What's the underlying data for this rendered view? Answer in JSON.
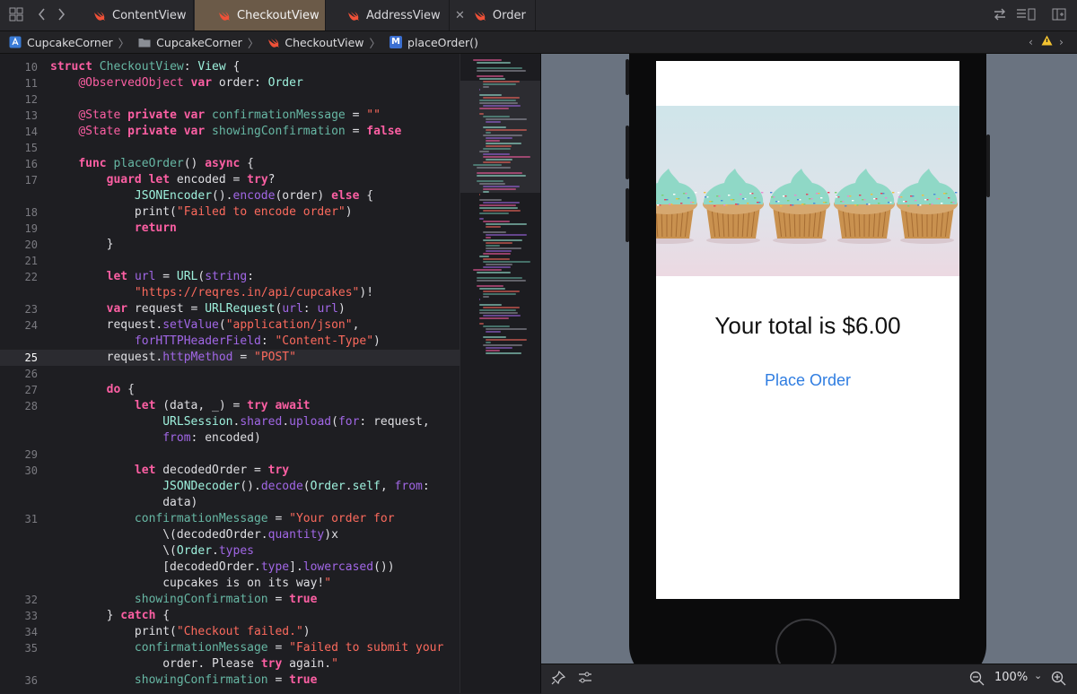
{
  "tabs": {
    "items": [
      {
        "label": "ContentView"
      },
      {
        "label": "CheckoutView"
      },
      {
        "label": "AddressView"
      },
      {
        "label": "Order"
      }
    ]
  },
  "breadcrumb": {
    "project": "CupcakeCorner",
    "folder": "CupcakeCorner",
    "file": "CheckoutView",
    "method_badge": "M",
    "method": "placeOrder()"
  },
  "editor": {
    "lines": [
      {
        "n": "10",
        "code": "struct CheckoutView: View {"
      },
      {
        "n": "11",
        "code": "    @ObservedObject var order: Order"
      },
      {
        "n": "12",
        "code": ""
      },
      {
        "n": "13",
        "code": "    @State private var confirmationMessage = \"\""
      },
      {
        "n": "14",
        "code": "    @State private var showingConfirmation = false"
      },
      {
        "n": "15",
        "code": ""
      },
      {
        "n": "16",
        "code": "    func placeOrder() async {"
      },
      {
        "n": "17",
        "code": "        guard let encoded = try?"
      },
      {
        "n": "",
        "code": "            JSONEncoder().encode(order) else {"
      },
      {
        "n": "18",
        "code": "            print(\"Failed to encode order\")"
      },
      {
        "n": "19",
        "code": "            return"
      },
      {
        "n": "20",
        "code": "        }"
      },
      {
        "n": "21",
        "code": ""
      },
      {
        "n": "22",
        "code": "        let url = URL(string:"
      },
      {
        "n": "",
        "code": "            \"https://reqres.in/api/cupcakes\")!"
      },
      {
        "n": "23",
        "code": "        var request = URLRequest(url: url)"
      },
      {
        "n": "24",
        "code": "        request.setValue(\"application/json\","
      },
      {
        "n": "",
        "code": "            forHTTPHeaderField: \"Content-Type\")"
      },
      {
        "n": "25",
        "code": "        request.httpMethod = \"POST\""
      },
      {
        "n": "26",
        "code": ""
      },
      {
        "n": "27",
        "code": "        do {"
      },
      {
        "n": "28",
        "code": "            let (data, _) = try await"
      },
      {
        "n": "",
        "code": "                URLSession.shared.upload(for: request,"
      },
      {
        "n": "",
        "code": "                from: encoded)"
      },
      {
        "n": "29",
        "code": ""
      },
      {
        "n": "30",
        "code": "            let decodedOrder = try"
      },
      {
        "n": "",
        "code": "                JSONDecoder().decode(Order.self, from:"
      },
      {
        "n": "",
        "code": "                data)"
      },
      {
        "n": "31",
        "code": "            confirmationMessage = \"Your order for"
      },
      {
        "n": "",
        "code": "                \\(decodedOrder.quantity)x"
      },
      {
        "n": "",
        "code": "                \\(Order.types"
      },
      {
        "n": "",
        "code": "                [decodedOrder.type].lowercased())"
      },
      {
        "n": "",
        "code": "                cupcakes is on its way!\""
      },
      {
        "n": "32",
        "code": "            showingConfirmation = true"
      },
      {
        "n": "33",
        "code": "        } catch {"
      },
      {
        "n": "34",
        "code": "            print(\"Checkout failed.\")"
      },
      {
        "n": "35",
        "code": "            confirmationMessage = \"Failed to submit your"
      },
      {
        "n": "",
        "code": "                order. Please try again.\""
      },
      {
        "n": "36",
        "code": "            showingConfirmation = true"
      }
    ],
    "current_line": "25"
  },
  "preview": {
    "total_text": "Your total is $6.00",
    "button_label": "Place Order"
  },
  "bottom_bar": {
    "zoom": "100%"
  },
  "colors": {
    "accent_tab": "#6b5a48",
    "swift_orange": "#f05138",
    "button_blue": "#2f7de1",
    "keyword_pink": "#fc5fa3",
    "string_red": "#fc6a5d",
    "type_teal": "#9ef1dd",
    "func_green": "#67b7a4",
    "property_purple": "#a167e6"
  }
}
